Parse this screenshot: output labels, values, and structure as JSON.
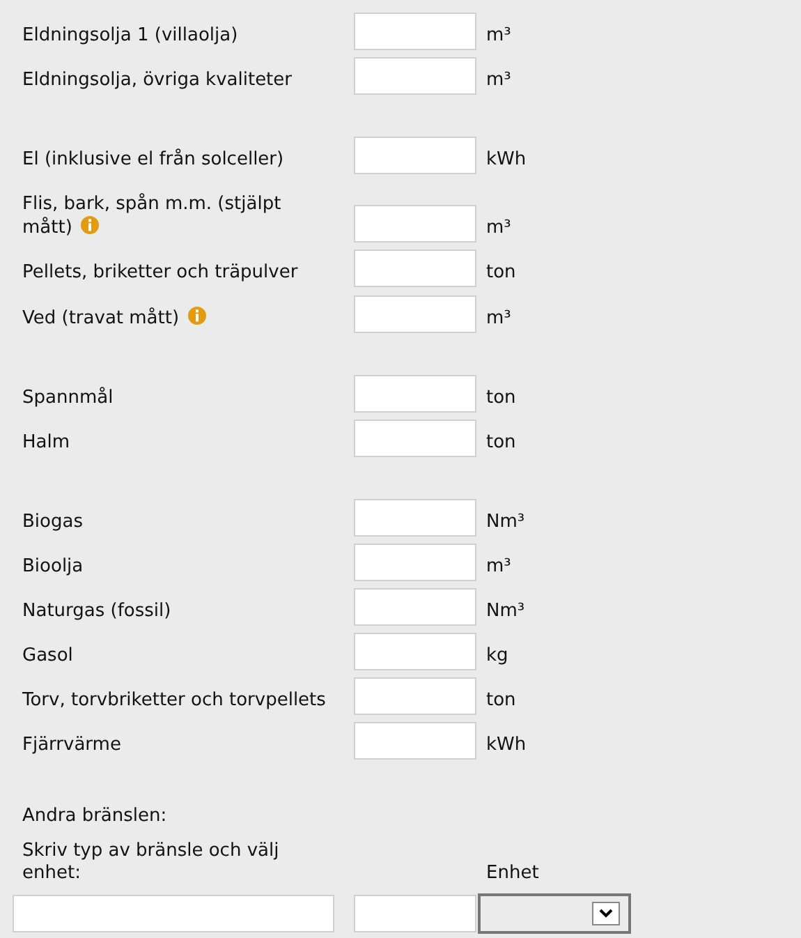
{
  "groups": [
    {
      "rows": [
        {
          "label": "Eldningsolja 1 (villaolja)",
          "info": false,
          "unit": "m³"
        },
        {
          "label": "Eldningsolja, övriga kvaliteter",
          "info": false,
          "unit": "m³"
        }
      ]
    },
    {
      "rows": [
        {
          "label": "El (inklusive el från solceller)",
          "info": false,
          "unit": "kWh"
        },
        {
          "label": "Flis, bark, spån m.m. (stjälpt mått)",
          "info": true,
          "unit": "m³"
        },
        {
          "label": "Pellets, briketter och träpulver",
          "info": false,
          "unit": "ton"
        },
        {
          "label": "Ved (travat mått)",
          "info": true,
          "unit": "m³"
        }
      ]
    },
    {
      "rows": [
        {
          "label": "Spannmål",
          "info": false,
          "unit": "ton"
        },
        {
          "label": "Halm",
          "info": false,
          "unit": "ton"
        }
      ]
    },
    {
      "rows": [
        {
          "label": "Biogas",
          "info": false,
          "unit": "Nm³"
        },
        {
          "label": "Bioolja",
          "info": false,
          "unit": "m³"
        },
        {
          "label": "Naturgas (fossil)",
          "info": false,
          "unit": "Nm³"
        },
        {
          "label": "Gasol",
          "info": false,
          "unit": "kg"
        },
        {
          "label": "Torv, torvbriketter och torvpellets",
          "info": false,
          "unit": "ton"
        },
        {
          "label": "Fjärrvärme",
          "info": false,
          "unit": "kWh"
        }
      ]
    }
  ],
  "other": {
    "heading": "Andra bränslen:",
    "instruction": "Skriv typ av bränsle och välj enhet:",
    "unit_header": "Enhet"
  }
}
